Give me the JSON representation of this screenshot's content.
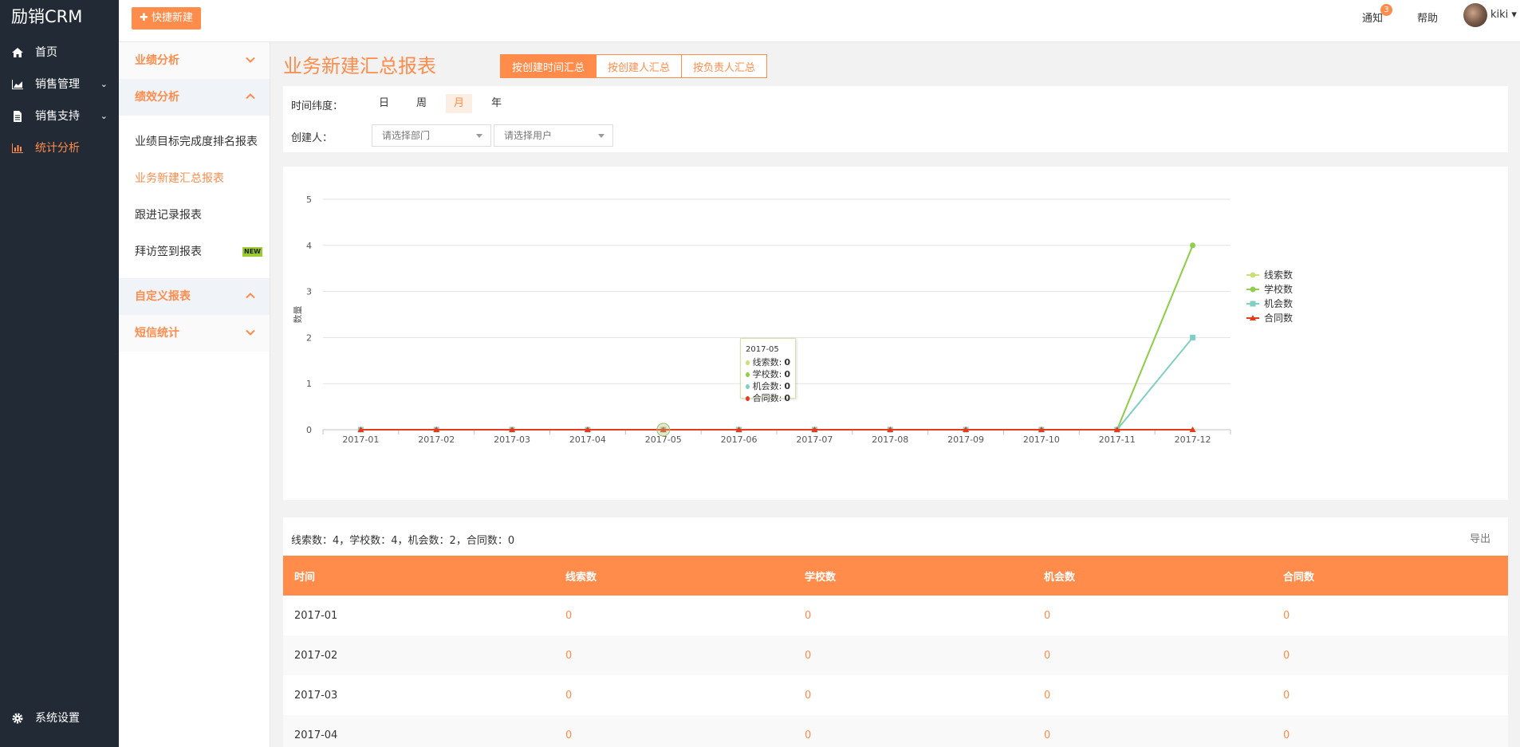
{
  "sidebar": {
    "brand": "励销CRM",
    "items": [
      {
        "label": "首页",
        "icon": "home-icon"
      },
      {
        "label": "销售管理",
        "icon": "area-chart-icon"
      },
      {
        "label": "销售支持",
        "icon": "document-icon"
      },
      {
        "label": "统计分析",
        "icon": "bar-chart-icon"
      }
    ],
    "settings": "系统设置"
  },
  "header": {
    "quick_new": "快捷新建",
    "notice": "通知",
    "notice_count": "3",
    "help": "帮助",
    "user": "kiki"
  },
  "submenu": {
    "group1": "业绩分析",
    "group2": "绩效分析",
    "items": [
      "业绩目标完成度排名报表",
      "业务新建汇总报表",
      "跟进记录报表",
      "拜访签到报表"
    ],
    "new_tag": "NEW",
    "group3": "自定义报表",
    "group4": "短信统计"
  },
  "main": {
    "title": "业务新建汇总报表",
    "tabs": [
      "按创建时间汇总",
      "按创建人汇总",
      "按负责人汇总"
    ],
    "time_label": "时间纬度：",
    "time_buttons": [
      "日",
      "周",
      "月",
      "年"
    ],
    "creator_label": "创建人：",
    "dept_placeholder": "请选择部门",
    "user_placeholder": "请选择用户"
  },
  "tooltip": {
    "title": "2017-05",
    "rows": [
      {
        "label": "线索数:",
        "value": "0"
      },
      {
        "label": "学校数:",
        "value": "0"
      },
      {
        "label": "机会数:",
        "value": "0"
      },
      {
        "label": "合同数:",
        "value": "0"
      }
    ]
  },
  "chart_data": {
    "type": "line",
    "ylabel": "数量",
    "ylim": [
      0,
      5
    ],
    "yticks": [
      0,
      1,
      2,
      3,
      4,
      5
    ],
    "categories": [
      "2017-01",
      "2017-02",
      "2017-03",
      "2017-04",
      "2017-05",
      "2017-06",
      "2017-07",
      "2017-08",
      "2017-09",
      "2017-10",
      "2017-11",
      "2017-12"
    ],
    "series": [
      {
        "name": "线索数",
        "color": "#c9e07a",
        "values": [
          0,
          0,
          0,
          0,
          0,
          0,
          0,
          0,
          0,
          0,
          0,
          4
        ]
      },
      {
        "name": "学校数",
        "color": "#8fce4f",
        "values": [
          0,
          0,
          0,
          0,
          0,
          0,
          0,
          0,
          0,
          0,
          0,
          4
        ]
      },
      {
        "name": "机会数",
        "color": "#7fcfc2",
        "values": [
          0,
          0,
          0,
          0,
          0,
          0,
          0,
          0,
          0,
          0,
          0,
          2
        ]
      },
      {
        "name": "合同数",
        "color": "#e63a1a",
        "values": [
          0,
          0,
          0,
          0,
          0,
          0,
          0,
          0,
          0,
          0,
          0,
          0
        ]
      }
    ],
    "legend": "right"
  },
  "table": {
    "summary": "线索数：4，学校数：4，机会数：2，合同数：0",
    "export": "导出",
    "headers": [
      "时间",
      "线索数",
      "学校数",
      "机会数",
      "合同数"
    ],
    "rows": [
      [
        "2017-01",
        "0",
        "0",
        "0",
        "0"
      ],
      [
        "2017-02",
        "0",
        "0",
        "0",
        "0"
      ],
      [
        "2017-03",
        "0",
        "0",
        "0",
        "0"
      ],
      [
        "2017-04",
        "0",
        "0",
        "0",
        "0"
      ]
    ]
  }
}
